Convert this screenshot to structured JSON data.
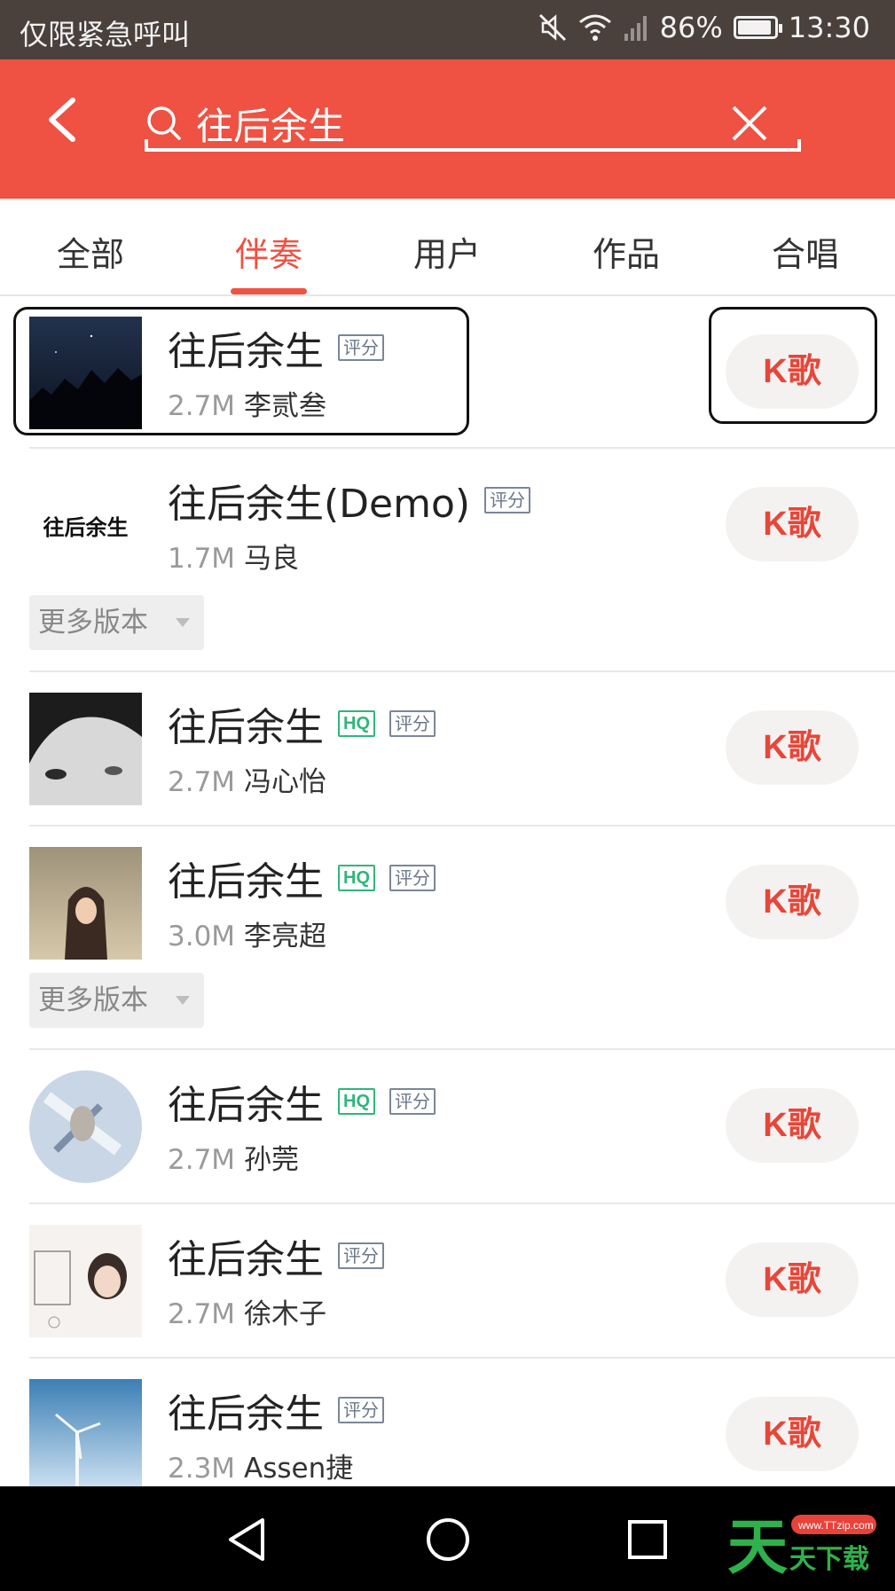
{
  "status_bar": {
    "carrier": "仅限紧急呼叫",
    "battery": "86%",
    "time": "13:30"
  },
  "search": {
    "value": "往后余生"
  },
  "tabs": [
    {
      "label": "全部"
    },
    {
      "label": "伴奏"
    },
    {
      "label": "用户"
    },
    {
      "label": "作品"
    },
    {
      "label": "合唱"
    }
  ],
  "list": [
    {
      "title": "往后余生",
      "badges": [
        "评分"
      ],
      "size": "2.7M",
      "artist": "李贰叁",
      "action": "K歌"
    },
    {
      "title": "往后余生(Demo)",
      "badges": [
        "评分"
      ],
      "size": "1.7M",
      "artist": "马良",
      "action": "K歌",
      "more": "更多版本",
      "cover_text": "往后余生"
    },
    {
      "title": "往后余生",
      "badges": [
        "HQ",
        "评分"
      ],
      "size": "2.7M",
      "artist": "冯心怡",
      "action": "K歌"
    },
    {
      "title": "往后余生",
      "badges": [
        "HQ",
        "评分"
      ],
      "size": "3.0M",
      "artist": "李亮超",
      "action": "K歌",
      "more": "更多版本"
    },
    {
      "title": "往后余生",
      "badges": [
        "HQ",
        "评分"
      ],
      "size": "2.7M",
      "artist": "孙莞",
      "action": "K歌"
    },
    {
      "title": "往后余生",
      "badges": [
        "评分"
      ],
      "size": "2.7M",
      "artist": "徐木子",
      "action": "K歌"
    },
    {
      "title": "往后余生",
      "badges": [
        "评分"
      ],
      "size": "2.3M",
      "artist": "Assen捷",
      "action": "K歌"
    }
  ],
  "watermark": {
    "url": "www.TTzip.com",
    "text": "天天下载"
  },
  "colors": {
    "accent": "#ef5142",
    "status_bar": "#4a403c",
    "hq_badge": "#2fb67a"
  }
}
